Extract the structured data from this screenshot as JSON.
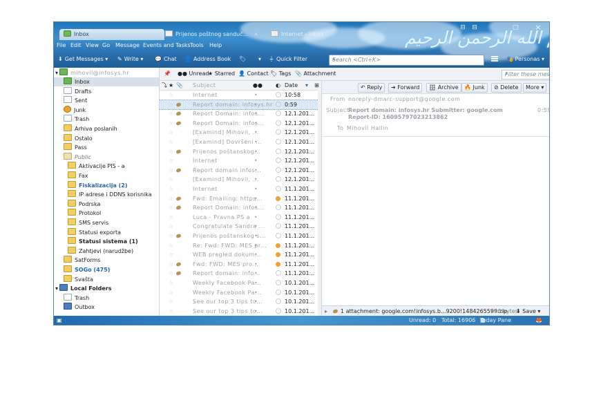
{
  "tabs": [
    {
      "label": "Inbox",
      "active": true
    },
    {
      "label": "Prijenos poštnog sanduč...",
      "active": false
    },
    {
      "label": "Internet - Inbox",
      "active": false
    }
  ],
  "header": {
    "calligraphy": "بسم الله الرحمن الرحيم",
    "close_glyph": "×",
    "window_max_glyph": "□"
  },
  "menu": [
    "File",
    "Edit",
    "View",
    "Go",
    "Message",
    "Events and Tasks",
    "Tools",
    "Help"
  ],
  "toolbar": {
    "get_messages": "Get Messages",
    "write": "Write",
    "chat": "Chat",
    "address_book": "Address Book",
    "quick_filter": "Quick Filter",
    "search_placeholder": "Search <Ctrl+K>",
    "personas": "Personas"
  },
  "account": {
    "name": "mihovil@infosys.hr"
  },
  "folders": [
    {
      "label": "Inbox",
      "icon": "inbox",
      "indent": 1,
      "selected": true
    },
    {
      "label": "Drafts",
      "icon": "white",
      "indent": 1
    },
    {
      "label": "Sent",
      "icon": "white",
      "indent": 1
    },
    {
      "label": "Junk",
      "icon": "junk",
      "indent": 1
    },
    {
      "label": "Trash",
      "icon": "white",
      "indent": 1
    },
    {
      "label": "Arhiva poslanih",
      "icon": "fold",
      "indent": 1
    },
    {
      "label": "Ostalo",
      "icon": "fold",
      "indent": 1
    },
    {
      "label": "Pass",
      "icon": "fold",
      "indent": 1
    },
    {
      "label": "Public",
      "icon": "pub",
      "indent": 1,
      "style": "ital"
    },
    {
      "label": "Aktivacije PIS - a",
      "icon": "fold",
      "indent": 2
    },
    {
      "label": "Fax",
      "icon": "fold",
      "indent": 2
    },
    {
      "label": "Fiskalizacija (2)",
      "icon": "fold",
      "indent": 2,
      "style": "blue"
    },
    {
      "label": "IP adrese i DDNS korisnika",
      "icon": "fold",
      "indent": 2
    },
    {
      "label": "Podrska",
      "icon": "fold",
      "indent": 2
    },
    {
      "label": "Protokol",
      "icon": "fold",
      "indent": 2
    },
    {
      "label": "SMS servis",
      "icon": "fold",
      "indent": 2
    },
    {
      "label": "Statusi exporta",
      "icon": "fold",
      "indent": 2
    },
    {
      "label": "Statusi sistema (1)",
      "icon": "fold",
      "indent": 2,
      "style": "bold"
    },
    {
      "label": "Zahtjevi (narudžbe)",
      "icon": "fold",
      "indent": 2
    },
    {
      "label": "SatForms",
      "icon": "fold",
      "indent": 1
    },
    {
      "label": "SOGo (475)",
      "icon": "fold",
      "indent": 1,
      "style": "blue"
    },
    {
      "label": "Svašta",
      "icon": "fold",
      "indent": 1
    },
    {
      "label": "Local Folders",
      "icon": "pc",
      "indent": 0,
      "style": "bold"
    },
    {
      "label": "Trash",
      "icon": "white",
      "indent": 1
    },
    {
      "label": "Outbox",
      "icon": "pc",
      "indent": 1
    }
  ],
  "quickfilter": {
    "unread": "Unread",
    "starred": "Starred",
    "contact": "Contact",
    "tags": "Tags",
    "attachment": "Attachment",
    "filter_placeholder": "Filter these messages <Ctrl+Shift+K>"
  },
  "thread_columns": {
    "subject": "Subject",
    "date": "Date"
  },
  "messages": [
    {
      "subject": "Internet",
      "date": "10:58",
      "attach": false,
      "junk": false
    },
    {
      "subject": "Report domain: infosys.hr",
      "date": "0:59",
      "attach": true,
      "junk": false,
      "selected": true
    },
    {
      "subject": "Report Domain: infos...",
      "date": "12.1.201...",
      "attach": true,
      "junk": false
    },
    {
      "subject": "Report Domain: infos...",
      "date": "12.1.201...",
      "attach": true,
      "junk": false
    },
    {
      "subject": "[Examind] Mihovil, ...",
      "date": "12.1.201...",
      "attach": false,
      "junk": false
    },
    {
      "subject": "[Examind] Dovršeni ...",
      "date": "12.1.201...",
      "attach": false,
      "junk": false
    },
    {
      "subject": "Prijenos poštanskog...",
      "date": "12.1.201...",
      "attach": true,
      "junk": false
    },
    {
      "subject": "Internet",
      "date": "12.1.201...",
      "attach": false,
      "junk": false
    },
    {
      "subject": "Report domain infos...",
      "date": "12.1.201...",
      "attach": true,
      "junk": false
    },
    {
      "subject": "[Examind] Mihovil, ...",
      "date": "12.1.201...",
      "attach": false,
      "junk": false
    },
    {
      "subject": "Internet",
      "date": "11.1.201...",
      "attach": false,
      "junk": false
    },
    {
      "subject": "Fwd: Emailing: https...",
      "date": "11.1.201...",
      "attach": true,
      "junk": true
    },
    {
      "subject": "Report Domain: infos...",
      "date": "11.1.201...",
      "attach": true,
      "junk": false
    },
    {
      "subject": "Luca - Pravna PS a",
      "date": "11.1.201...",
      "attach": false,
      "junk": false
    },
    {
      "subject": "Congratulate Sandra ...",
      "date": "11.1.201...",
      "attach": false,
      "junk": false
    },
    {
      "subject": "Prijenos poštanskog s...",
      "date": "11.1.201...",
      "attach": true,
      "junk": false
    },
    {
      "subject": "Re: Fwd: FWD: MES pr...",
      "date": "11.1.201...",
      "attach": false,
      "junk": true
    },
    {
      "subject": "WEB pregled dokum...",
      "date": "11.1.201...",
      "attach": false,
      "junk": true
    },
    {
      "subject": "Fwd: FWD: MES pro...",
      "date": "11.1.201...",
      "attach": true,
      "junk": true
    },
    {
      "subject": "Report domain: info...",
      "date": "11.1.201...",
      "attach": true,
      "junk": false
    },
    {
      "subject": "Weekly Facebook Pa...",
      "date": "10.1.201...",
      "attach": false,
      "junk": false
    },
    {
      "subject": "Weekly Facebook Pa...",
      "date": "10.1.201...",
      "attach": false,
      "junk": false
    },
    {
      "subject": "See our top 3 tips to...",
      "date": "10.1.201...",
      "attach": false,
      "junk": false
    },
    {
      "subject": "See our top 3 tips to...",
      "date": "10.1.201...",
      "attach": false,
      "junk": false
    },
    {
      "subject": "Weekly Facebook Pa...",
      "date": "10.1.201...",
      "attach": false,
      "junk": false
    },
    {
      "subject": "See our top 3 tips to...",
      "date": "10.1.201...",
      "attach": false,
      "junk": false
    }
  ],
  "message_view": {
    "reply": "Reply",
    "forward": "Forward",
    "archive": "Archive",
    "junk": "Junk",
    "delete": "Delete",
    "more": "More",
    "from_label": "From",
    "from": "noreply-dmarc-support@google.com",
    "subject_label": "Subject",
    "subject": "Report domain: infosys.hr Submitter: google.com Report-ID: 16095797023213862",
    "time": "0:59",
    "to_label": "To",
    "to": "Mihovil Hallin"
  },
  "attachment_bar": {
    "text": "1 attachment: google.com!infosys.b...9200!1484265599.zip",
    "size": "656 bytes",
    "save": "Save"
  },
  "statusbar": {
    "unread": "Unread: 0",
    "total": "Total: 16906",
    "today_pane": "Today Pane"
  }
}
